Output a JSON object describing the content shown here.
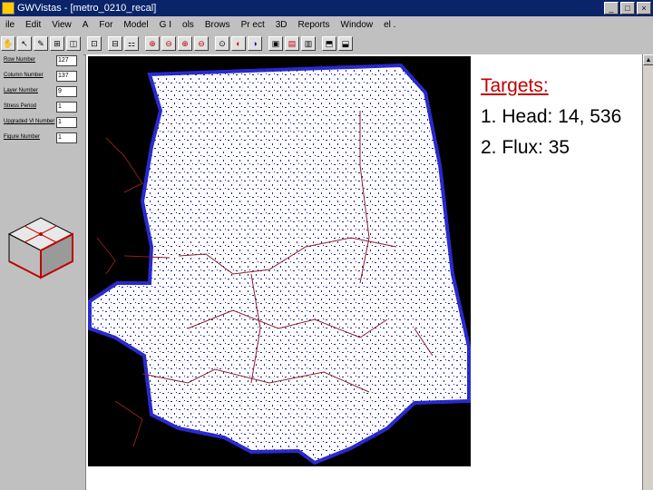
{
  "window": {
    "title": "GWVistas - [metro_0210_recal]"
  },
  "menu": [
    "ile",
    "Edit",
    "View",
    "A",
    "For",
    "Model",
    "G I",
    "ols",
    "Brows",
    "Pr ect",
    "3D",
    "Reports",
    "Window",
    "el ."
  ],
  "toolbar": [
    "✋",
    "↖",
    "✎",
    "⊞",
    "◫",
    "⊡",
    "⊟",
    "⚏",
    "⊕",
    "⊖",
    "⊕",
    "⊖",
    "⊙",
    "◐",
    "◑",
    "▣",
    "▤",
    "▥",
    "⬒",
    "⬓"
  ],
  "left_panel": {
    "fields": [
      {
        "label": "Row Number",
        "value": "127"
      },
      {
        "label": "Column Number",
        "value": "137"
      },
      {
        "label": "Layer Number",
        "value": "9"
      },
      {
        "label": "Stress Period",
        "value": "1"
      },
      {
        "label": "Upgraded Vl Number",
        "value": "1"
      },
      {
        "label": "Figure Number",
        "value": "1"
      }
    ]
  },
  "content": {
    "heading": "Targets:",
    "items": [
      "1. Head: 14, 536",
      "2. Flux: 35"
    ]
  },
  "colors": {
    "accent": "#c00000",
    "map_background": "#000000",
    "target_marks": "#1a1aa8"
  }
}
